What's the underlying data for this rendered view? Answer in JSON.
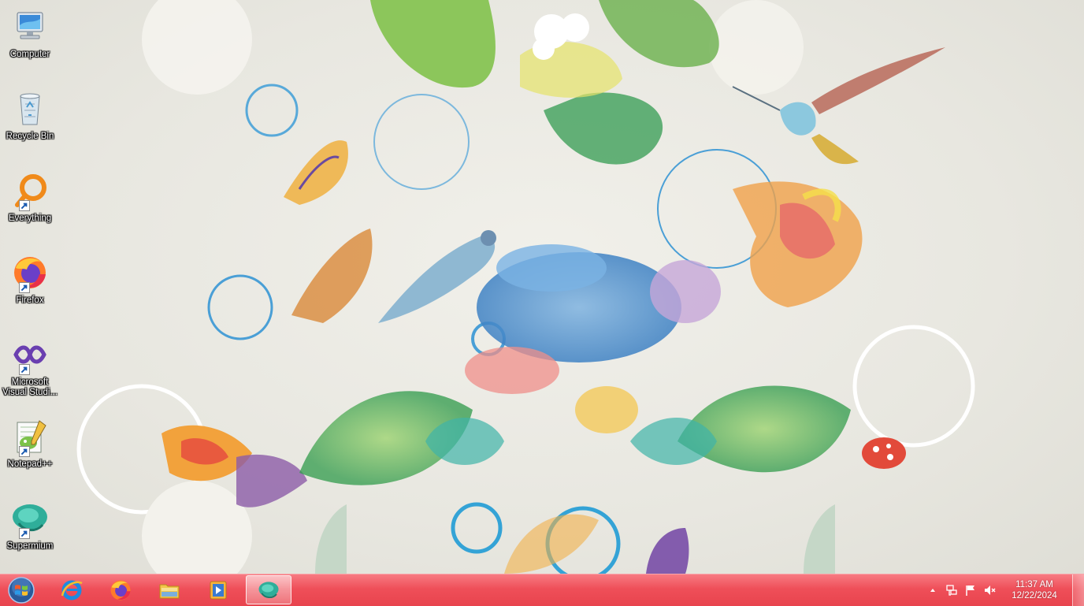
{
  "desktop": {
    "icons": [
      {
        "label": "Computer",
        "icon": "computer-icon",
        "shortcut": false
      },
      {
        "label": "Recycle Bin",
        "icon": "recycle-bin-icon",
        "shortcut": false
      },
      {
        "label": "Everything",
        "icon": "everything-search-icon",
        "shortcut": true
      },
      {
        "label": "Firefox",
        "icon": "firefox-icon",
        "shortcut": true
      },
      {
        "label": "Microsoft Visual Studi...",
        "icon": "visual-studio-icon",
        "shortcut": true
      },
      {
        "label": "Notepad++",
        "icon": "notepad-plus-plus-icon",
        "shortcut": true
      },
      {
        "label": "Supermium",
        "icon": "supermium-icon",
        "shortcut": true
      }
    ]
  },
  "taskbar": {
    "start": {
      "icon": "windows-start-orb-icon"
    },
    "pinned": [
      {
        "name": "Internet Explorer",
        "icon": "internet-explorer-icon",
        "active": false
      },
      {
        "name": "Firefox",
        "icon": "firefox-icon",
        "active": false
      },
      {
        "name": "Windows Explorer",
        "icon": "folder-explorer-icon",
        "active": false
      },
      {
        "name": "Windows Media Player",
        "icon": "media-player-icon",
        "active": false
      },
      {
        "name": "Supermium",
        "icon": "supermium-icon",
        "active": true
      }
    ],
    "tray": {
      "icons": [
        "show-hidden-icons-chevron",
        "network-icon",
        "action-center-flag-icon",
        "volume-muted-icon"
      ]
    },
    "clock": {
      "time": "11:37 AM",
      "date": "12/22/2024"
    }
  },
  "colors": {
    "taskbar": "#ef4f59",
    "desktop_background": "#e9e8e2"
  }
}
